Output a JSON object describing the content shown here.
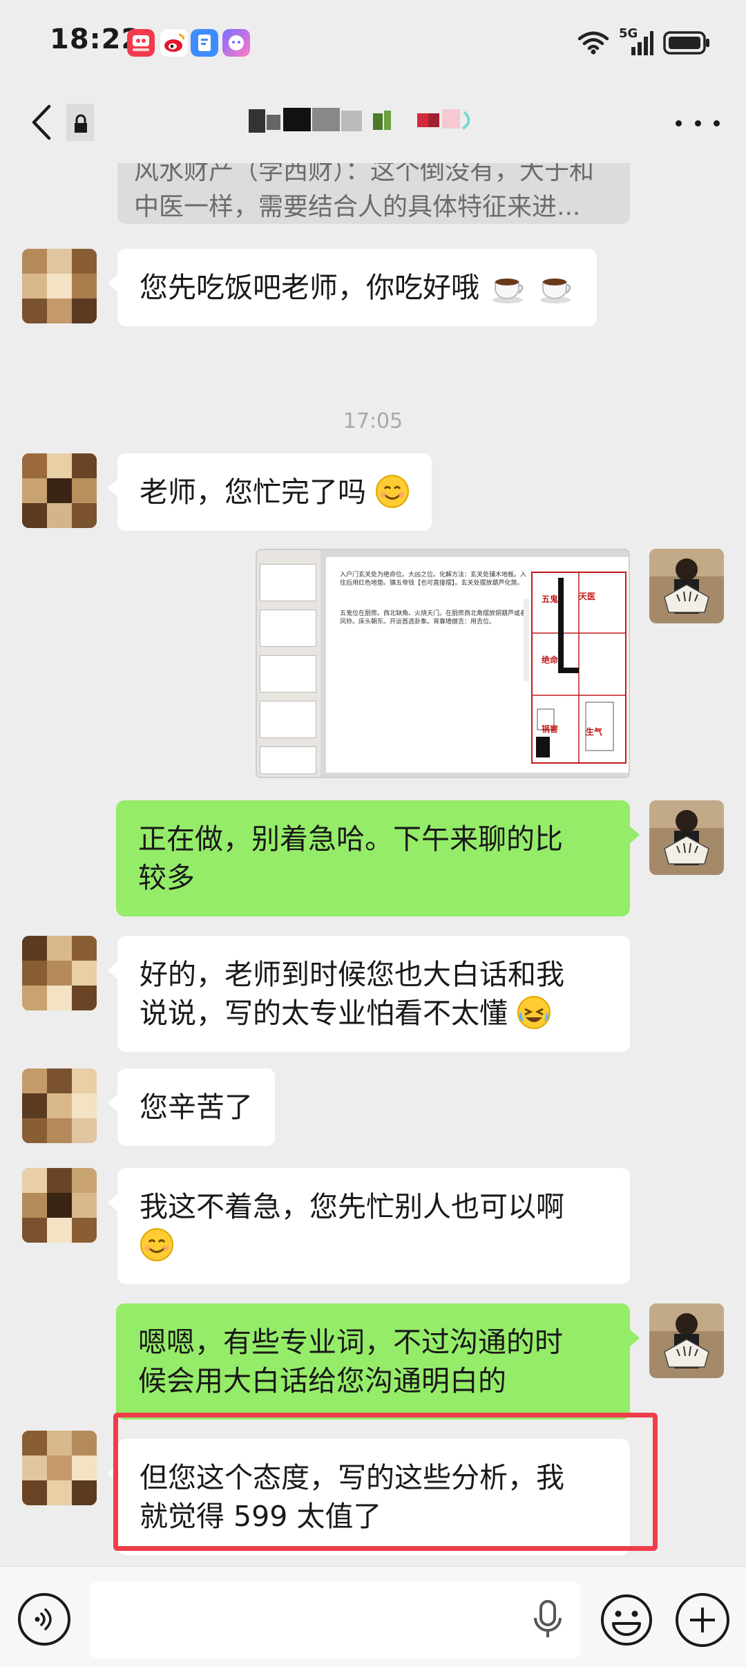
{
  "status_bar": {
    "time": "18:22",
    "network": "5G",
    "app_icons": [
      "video-app-icon",
      "weibo-icon",
      "browser-icon",
      "chat-app-icon"
    ]
  },
  "header": {
    "back_icon": "chevron-left-icon",
    "title_obscured": true,
    "more_icon": "more-dots-icon"
  },
  "quoted_message": {
    "line1": "风水财产（学西财）：这个倒没有，大于和",
    "line2": "中医一样，需要结合人的具体特征来进..."
  },
  "messages": [
    {
      "id": "m1",
      "side": "in",
      "text": "您先吃饭吧老师，你吃好哦",
      "emoji": [
        "coffee-cup-icon",
        "coffee-cup-icon"
      ]
    },
    {
      "id": "m2",
      "side": "in",
      "text": "老师，您忙完了吗",
      "emoji": [
        "smiling-face-icon"
      ]
    },
    {
      "id": "m3",
      "side": "out",
      "type": "image",
      "image_label": "floor-plan-analysis-screenshot"
    },
    {
      "id": "m4",
      "side": "out",
      "line1": "正在做，别着急哈。下午来聊的比",
      "line2": "较多"
    },
    {
      "id": "m5",
      "side": "in",
      "line1": "好的，老师到时候您也大白话和我",
      "line2": "说说，写的太专业怕看不太懂",
      "emoji": [
        "sweat-laugh-face-icon"
      ]
    },
    {
      "id": "m6",
      "side": "in",
      "text": "您辛苦了"
    },
    {
      "id": "m7",
      "side": "in",
      "line1": "我这不着急，您先忙别人也可以啊",
      "emoji": [
        "smiling-face-icon"
      ]
    },
    {
      "id": "m8",
      "side": "out",
      "line1": "嗯嗯，有些专业词，不过沟通的时",
      "line2": "候会用大白话给您沟通明白的"
    },
    {
      "id": "m9",
      "side": "in",
      "highlighted": true,
      "line1": "但您这个态度，写的这些分析，我",
      "line2": "就觉得 599 太值了"
    }
  ],
  "time_separator": "17:05",
  "image_message": {
    "note1": "入户门玄关处为绝命位。大凶之位。化解方法：玄关处铺木地板。入住后用红色地垫。镇五帝钱【也可直接摆】。玄关处摆放葫芦化煞。",
    "note2": "五鬼位在厨房。西北缺角。火烧天门。在厨房西北角摆放铜葫芦或者风铃。床头朝东。开运首选卦象。背靠墙做吉：用吉位。",
    "rooms": [
      "五鬼",
      "天医",
      "绝命",
      "祸害",
      "生气"
    ]
  },
  "input_bar": {
    "voice_icon": "voice-mode-icon",
    "mic_icon": "microphone-icon",
    "emoji_icon": "emoji-icon",
    "plus_icon": "plus-icon",
    "placeholder": ""
  },
  "colors": {
    "background": "#ededed",
    "incoming_bubble": "#ffffff",
    "outgoing_bubble": "#95ec69",
    "highlight": "#ef3e4a"
  }
}
